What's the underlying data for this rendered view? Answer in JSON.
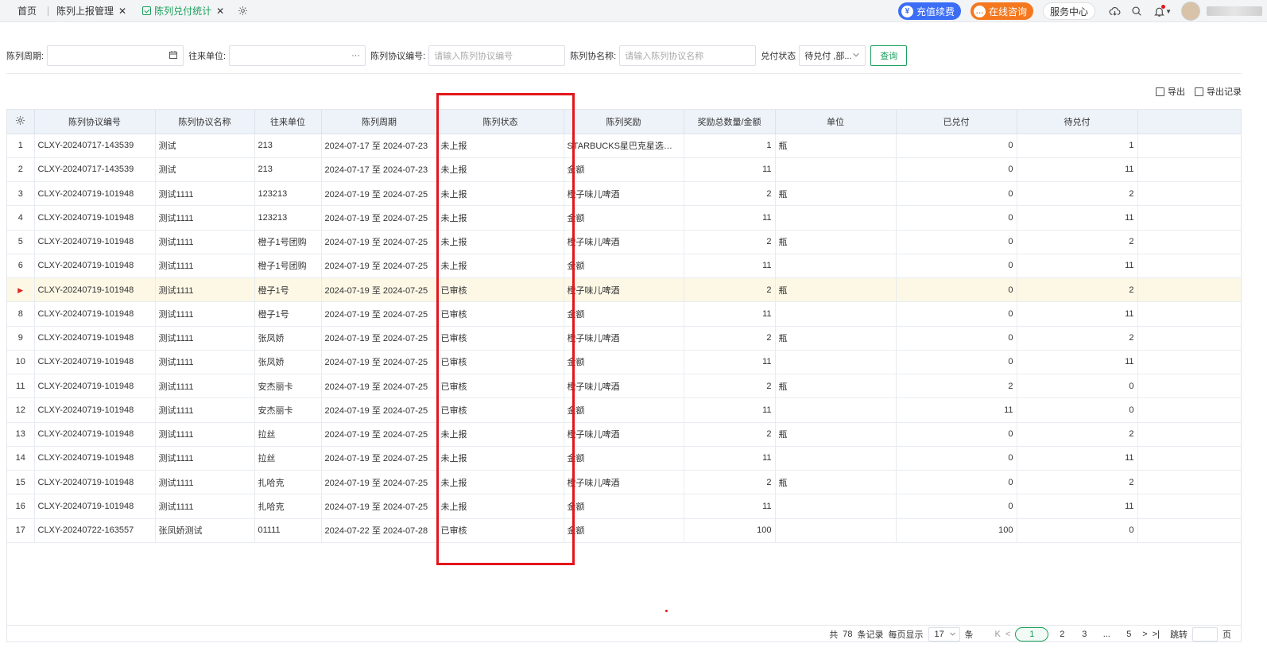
{
  "tabs": {
    "home": "首页",
    "report_mgmt": "陈列上报管理",
    "payment_stats": "陈列兑付统计"
  },
  "topright": {
    "recharge": "充值续费",
    "consult": "在线咨询",
    "service_center": "服务中心"
  },
  "filters": {
    "period_label": "陈列周期:",
    "partner_label": "往来单位:",
    "agreement_no_label": "陈列协议编号:",
    "agreement_no_placeholder": "请输入陈列协议编号",
    "agreement_name_label": "陈列协名称:",
    "agreement_name_placeholder": "请输入陈列协议名称",
    "status_label": "兑付状态",
    "status_value": "待兑付 ,部...",
    "query_button": "查询"
  },
  "exports": {
    "export": "导出",
    "export_records": "导出记录"
  },
  "table": {
    "headers": [
      "陈列协议编号",
      "陈列协议名称",
      "往来单位",
      "陈列周期",
      "陈列状态",
      "陈列奖励",
      "奖励总数量/金额",
      "单位",
      "已兑付",
      "待兑付"
    ],
    "rows": [
      [
        "1",
        "CLXY-20240717-143539",
        "测试",
        "213",
        "2024-07-17 至 2024-07-23",
        "未上报",
        "STARBUCKS星巴克星选顺滑...",
        "1",
        "瓶",
        "0",
        "1"
      ],
      [
        "2",
        "CLXY-20240717-143539",
        "测试",
        "213",
        "2024-07-17 至 2024-07-23",
        "未上报",
        "金额",
        "11",
        "",
        "0",
        "11"
      ],
      [
        "3",
        "CLXY-20240719-101948",
        "测试1111",
        "123213",
        "2024-07-19 至 2024-07-25",
        "未上报",
        "橙子味儿啤酒",
        "2",
        "瓶",
        "0",
        "2"
      ],
      [
        "4",
        "CLXY-20240719-101948",
        "测试1111",
        "123213",
        "2024-07-19 至 2024-07-25",
        "未上报",
        "金额",
        "11",
        "",
        "0",
        "11"
      ],
      [
        "5",
        "CLXY-20240719-101948",
        "测试1111",
        "橙子1号团购",
        "2024-07-19 至 2024-07-25",
        "未上报",
        "橙子味儿啤酒",
        "2",
        "瓶",
        "0",
        "2"
      ],
      [
        "6",
        "CLXY-20240719-101948",
        "测试1111",
        "橙子1号团购",
        "2024-07-19 至 2024-07-25",
        "未上报",
        "金额",
        "11",
        "",
        "0",
        "11"
      ],
      [
        "",
        "CLXY-20240719-101948",
        "测试1111",
        "橙子1号",
        "2024-07-19 至 2024-07-25",
        "已审核",
        "橙子味儿啤酒",
        "2",
        "瓶",
        "0",
        "2"
      ],
      [
        "8",
        "CLXY-20240719-101948",
        "测试1111",
        "橙子1号",
        "2024-07-19 至 2024-07-25",
        "已审核",
        "金额",
        "11",
        "",
        "0",
        "11"
      ],
      [
        "9",
        "CLXY-20240719-101948",
        "测试1111",
        "张凤娇",
        "2024-07-19 至 2024-07-25",
        "已审核",
        "橙子味儿啤酒",
        "2",
        "瓶",
        "0",
        "2"
      ],
      [
        "10",
        "CLXY-20240719-101948",
        "测试1111",
        "张凤娇",
        "2024-07-19 至 2024-07-25",
        "已审核",
        "金额",
        "11",
        "",
        "0",
        "11"
      ],
      [
        "11",
        "CLXY-20240719-101948",
        "测试1111",
        "安杰丽卡",
        "2024-07-19 至 2024-07-25",
        "已审核",
        "橙子味儿啤酒",
        "2",
        "瓶",
        "2",
        "0"
      ],
      [
        "12",
        "CLXY-20240719-101948",
        "测试1111",
        "安杰丽卡",
        "2024-07-19 至 2024-07-25",
        "已审核",
        "金额",
        "11",
        "",
        "11",
        "0"
      ],
      [
        "13",
        "CLXY-20240719-101948",
        "测试1111",
        "拉丝",
        "2024-07-19 至 2024-07-25",
        "未上报",
        "橙子味儿啤酒",
        "2",
        "瓶",
        "0",
        "2"
      ],
      [
        "14",
        "CLXY-20240719-101948",
        "测试1111",
        "拉丝",
        "2024-07-19 至 2024-07-25",
        "未上报",
        "金额",
        "11",
        "",
        "0",
        "11"
      ],
      [
        "15",
        "CLXY-20240719-101948",
        "测试1111",
        "扎哈克",
        "2024-07-19 至 2024-07-25",
        "未上报",
        "橙子味儿啤酒",
        "2",
        "瓶",
        "0",
        "2"
      ],
      [
        "16",
        "CLXY-20240719-101948",
        "测试1111",
        "扎哈克",
        "2024-07-19 至 2024-07-25",
        "未上报",
        "金额",
        "11",
        "",
        "0",
        "11"
      ],
      [
        "17",
        "CLXY-20240722-163557",
        "张凤娇测试",
        "01111",
        "2024-07-22 至 2024-07-28",
        "已审核",
        "金额",
        "100",
        "",
        "100",
        "0"
      ]
    ],
    "selected_row_index": 6
  },
  "pager": {
    "total_prefix": "共",
    "total": "78",
    "total_suffix": "条记录",
    "per_page_label": "每页显示",
    "per_page": "17",
    "per_page_unit": "条",
    "pages": [
      "1",
      "2",
      "3",
      "...",
      "5"
    ],
    "jump_label": "跳转",
    "page_unit": "页"
  },
  "colors": {
    "accent": "#1aa05a",
    "highlight": "#e3161b",
    "header_bg": "#eef3f9",
    "selected_row": "#fdf8e6"
  }
}
